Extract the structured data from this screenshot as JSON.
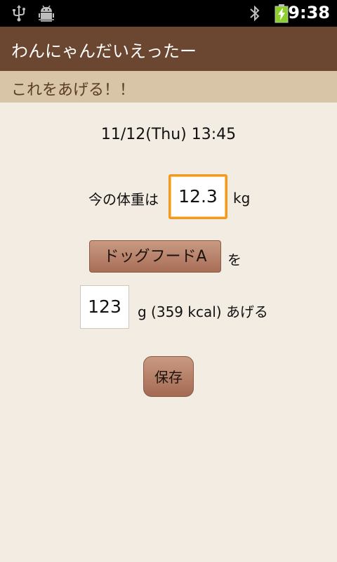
{
  "status_bar": {
    "time": "9:38",
    "icons": [
      "usb-icon",
      "android-debug-icon",
      "bluetooth-icon",
      "battery-charging-icon"
    ]
  },
  "app": {
    "title": "わんにゃんだいえったー",
    "subtitle": "これをあげる！！"
  },
  "form": {
    "datetime": "11/12(Thu) 13:45",
    "weight_label": "今の体重は",
    "weight_value": "12.3",
    "weight_unit": "kg",
    "food_button_label": "ドッグフードA",
    "food_suffix": "を",
    "amount_value": "123",
    "amount_suffix": "g (359 kcal) あげる",
    "save_label": "保存"
  },
  "colors": {
    "background": "#f3ece2",
    "title_bar": "#6b4630",
    "subtitle_bar": "#d8c4a6",
    "focus_border": "#f09a1e",
    "button": "#b78069"
  }
}
